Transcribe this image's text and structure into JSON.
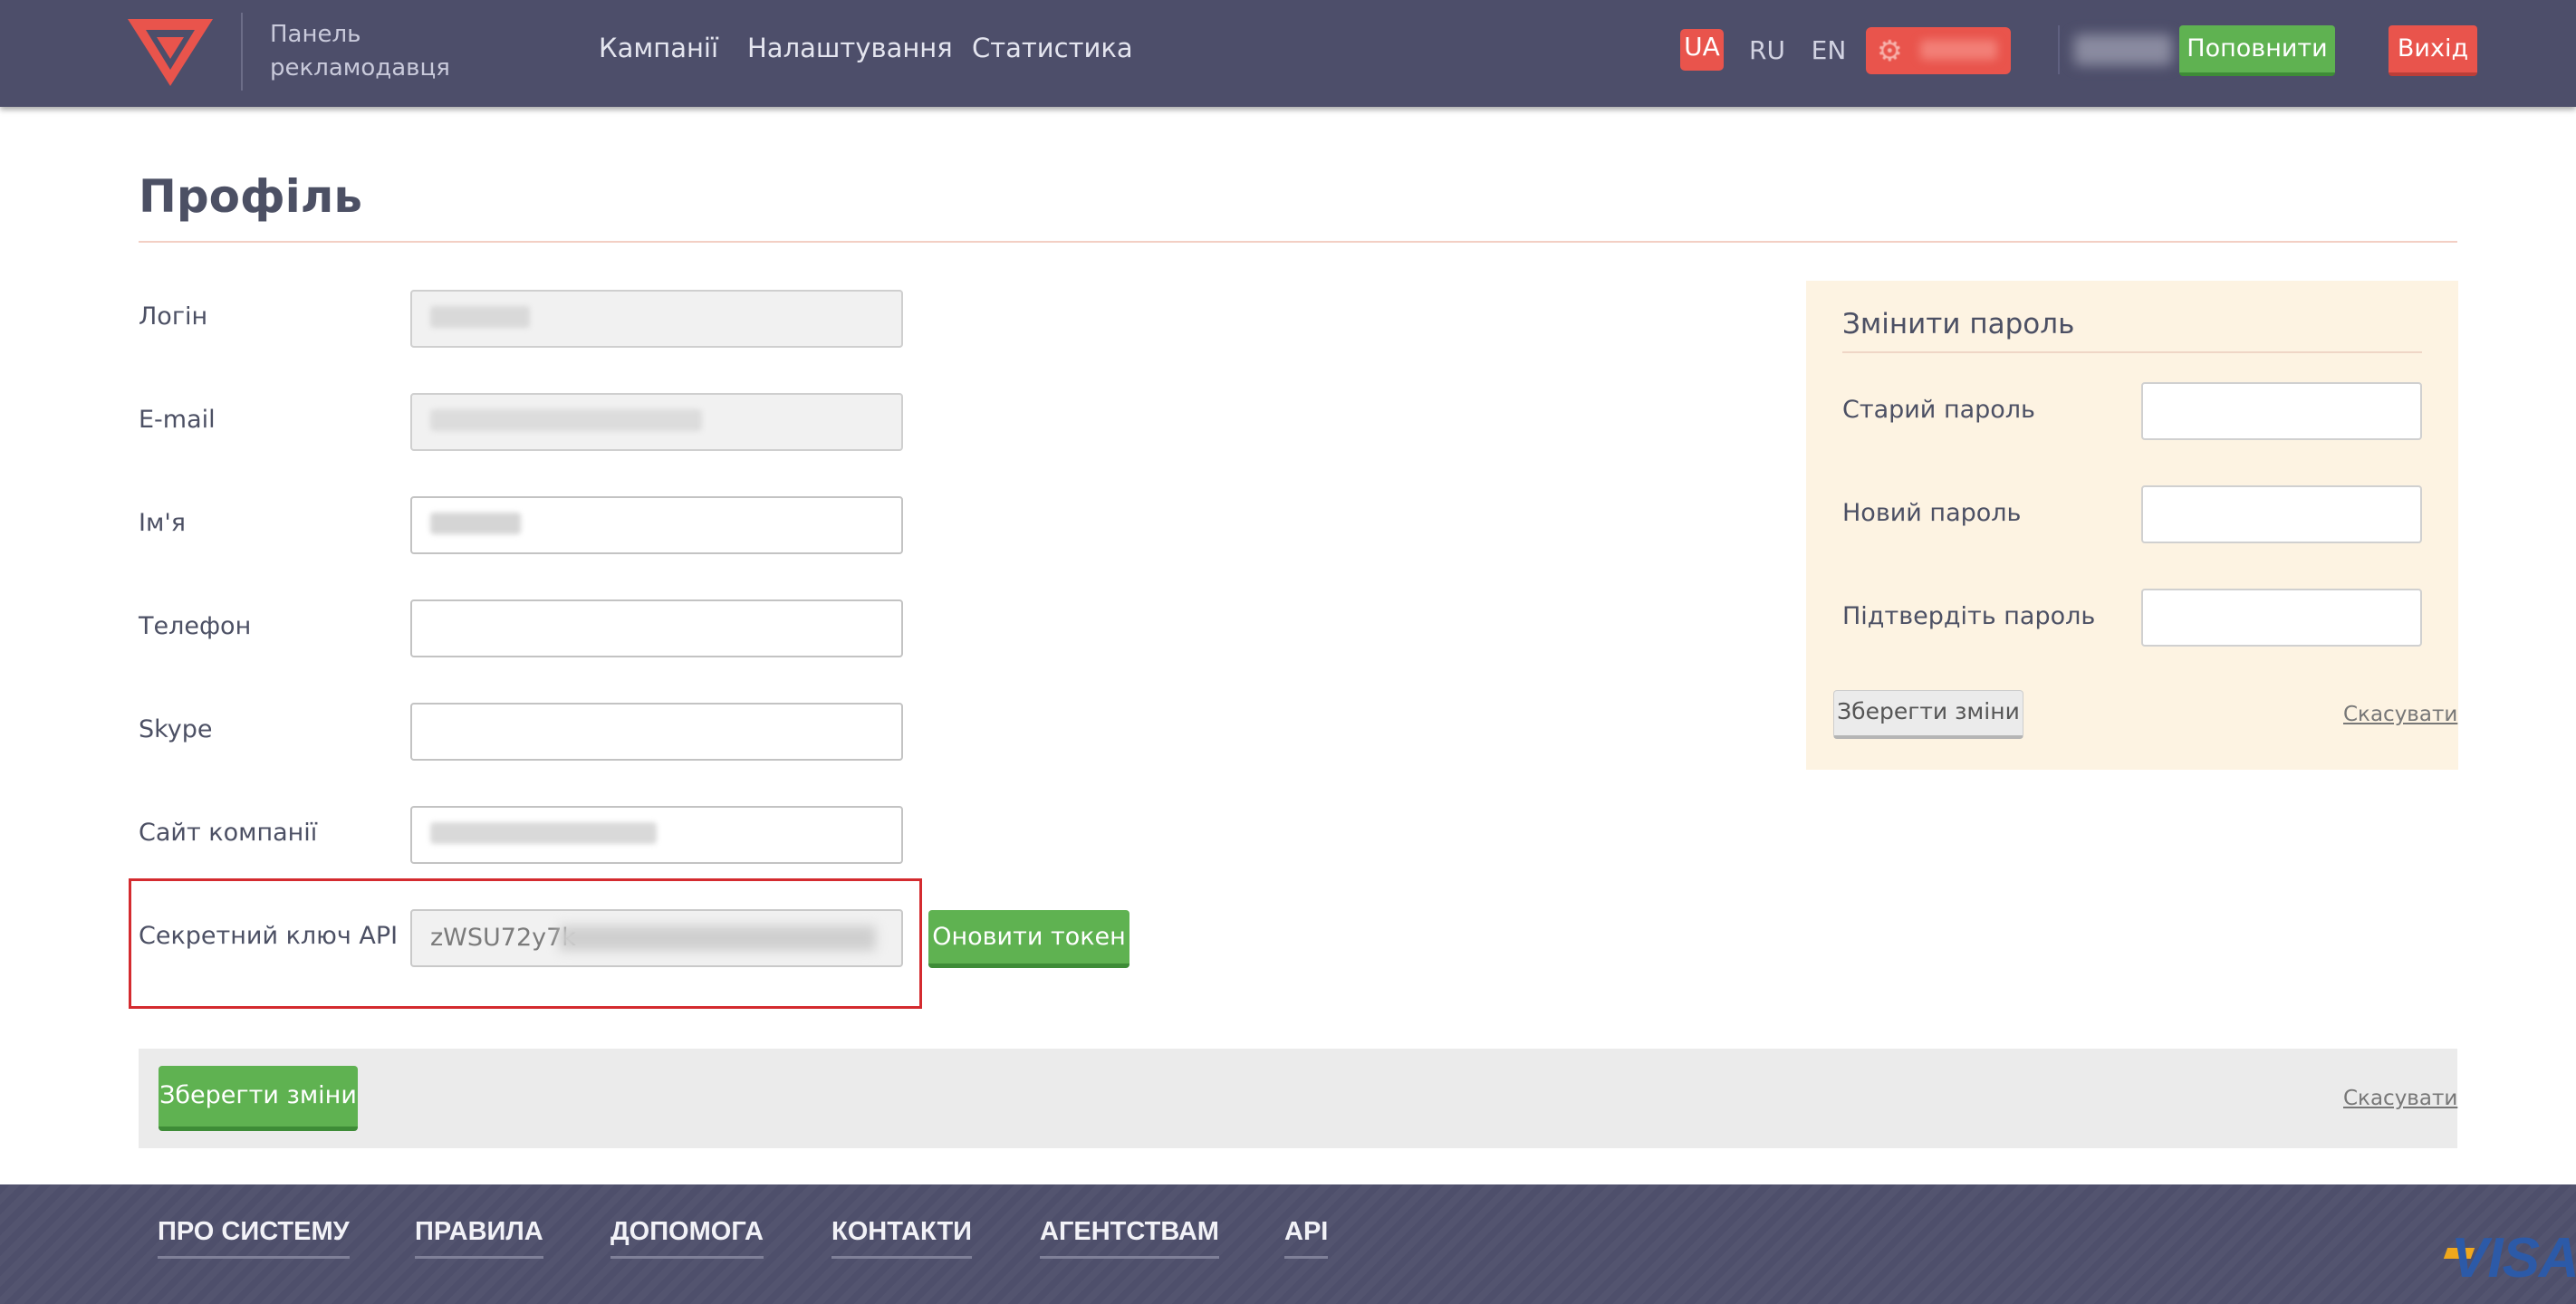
{
  "header": {
    "brand_line1": "Панель",
    "brand_line2": "рекламодавця",
    "nav": [
      "Кампанії",
      "Налаштування",
      "Статистика"
    ],
    "languages": [
      "UA",
      "RU",
      "EN"
    ],
    "active_language": "UA",
    "topup_label": "Поповнити",
    "exit_label": "Вихід"
  },
  "profile": {
    "title": "Профіль",
    "fields": {
      "login": {
        "label": "Логін"
      },
      "email": {
        "label": "E-mail"
      },
      "name": {
        "label": "Ім'я"
      },
      "phone": {
        "label": "Телефон",
        "value": ""
      },
      "skype": {
        "label": "Skype",
        "value": ""
      },
      "site": {
        "label": "Сайт компанії"
      },
      "api_key": {
        "label": "Секретний ключ API",
        "visible_value": "zWSU72y7k"
      }
    },
    "refresh_token_label": "Оновити токен",
    "save_label": "Зберегти зміни",
    "cancel_label": "Скасувати"
  },
  "password_panel": {
    "title": "Змінити пароль",
    "old_label": "Старий пароль",
    "new_label": "Новий пароль",
    "confirm_label": "Підтвердіть пароль",
    "save_label": "Зберегти зміни",
    "cancel_label": "Скасувати"
  },
  "footer": {
    "links": [
      "ПРО СИСТЕМУ",
      "ПРАВИЛА",
      "ДОПОМОГА",
      "КОНТАКТИ",
      "АГЕНТСТВАМ",
      "API"
    ],
    "payment_logo": "VISA"
  },
  "colors": {
    "header_bg": "#4d4e6a",
    "accent_red": "#e9544c",
    "accent_green": "#5fb251",
    "password_panel_bg": "#fdf3e2",
    "highlight_border": "#d42b2f"
  }
}
